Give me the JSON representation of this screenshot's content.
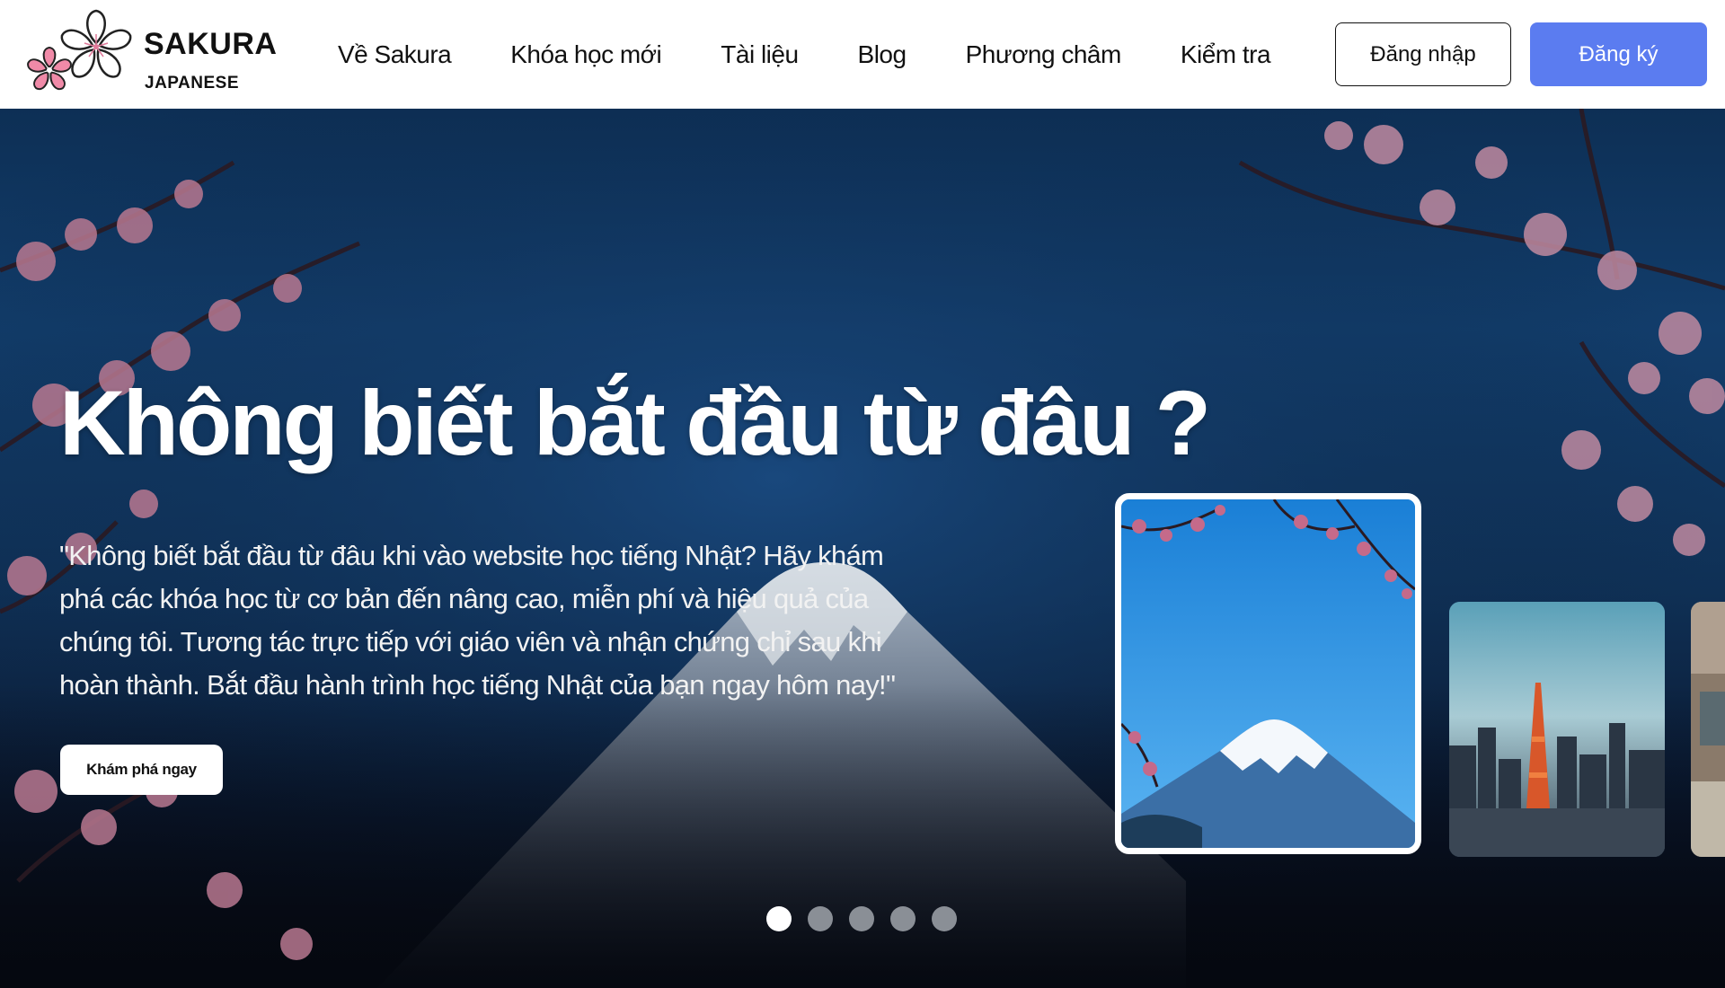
{
  "logo": {
    "title": "SAKURA",
    "subtitle": "JAPANESE",
    "icon": "sakura-flower-icon"
  },
  "nav": {
    "items": [
      {
        "label": "Về Sakura"
      },
      {
        "label": "Khóa học mới"
      },
      {
        "label": "Tài liệu"
      },
      {
        "label": "Blog"
      },
      {
        "label": "Phương châm"
      },
      {
        "label": "Kiểm tra"
      }
    ]
  },
  "auth": {
    "login_label": "Đăng nhập",
    "register_label": "Đăng ký"
  },
  "hero": {
    "title": "Không biết bắt đầu từ đâu ?",
    "description": "\"Không biết bắt đầu từ đâu khi vào website học tiếng Nhật? Hãy khám phá các khóa học từ cơ bản đến nâng cao, miễn phí và hiệu quả của chúng tôi. Tương tác trực tiếp với giáo viên và nhận chứng chỉ sau khi hoàn thành. Bắt đầu hành trình học tiếng Nhật của bạn ngay hôm nay!\"",
    "cta_label": "Khám phá ngay",
    "slides": [
      {
        "scene": "mount-fuji-cherry-blossom",
        "active": true
      },
      {
        "scene": "tokyo-tower-city",
        "active": false
      },
      {
        "scene": "japanese-street",
        "active": false
      }
    ],
    "pagination": {
      "count": 5,
      "active_index": 0
    }
  },
  "colors": {
    "accent": "#5b7cf0",
    "hero_bg": "#0f3055",
    "blossom": "#c98aa0",
    "dot_inactive": "#8a8f96"
  }
}
